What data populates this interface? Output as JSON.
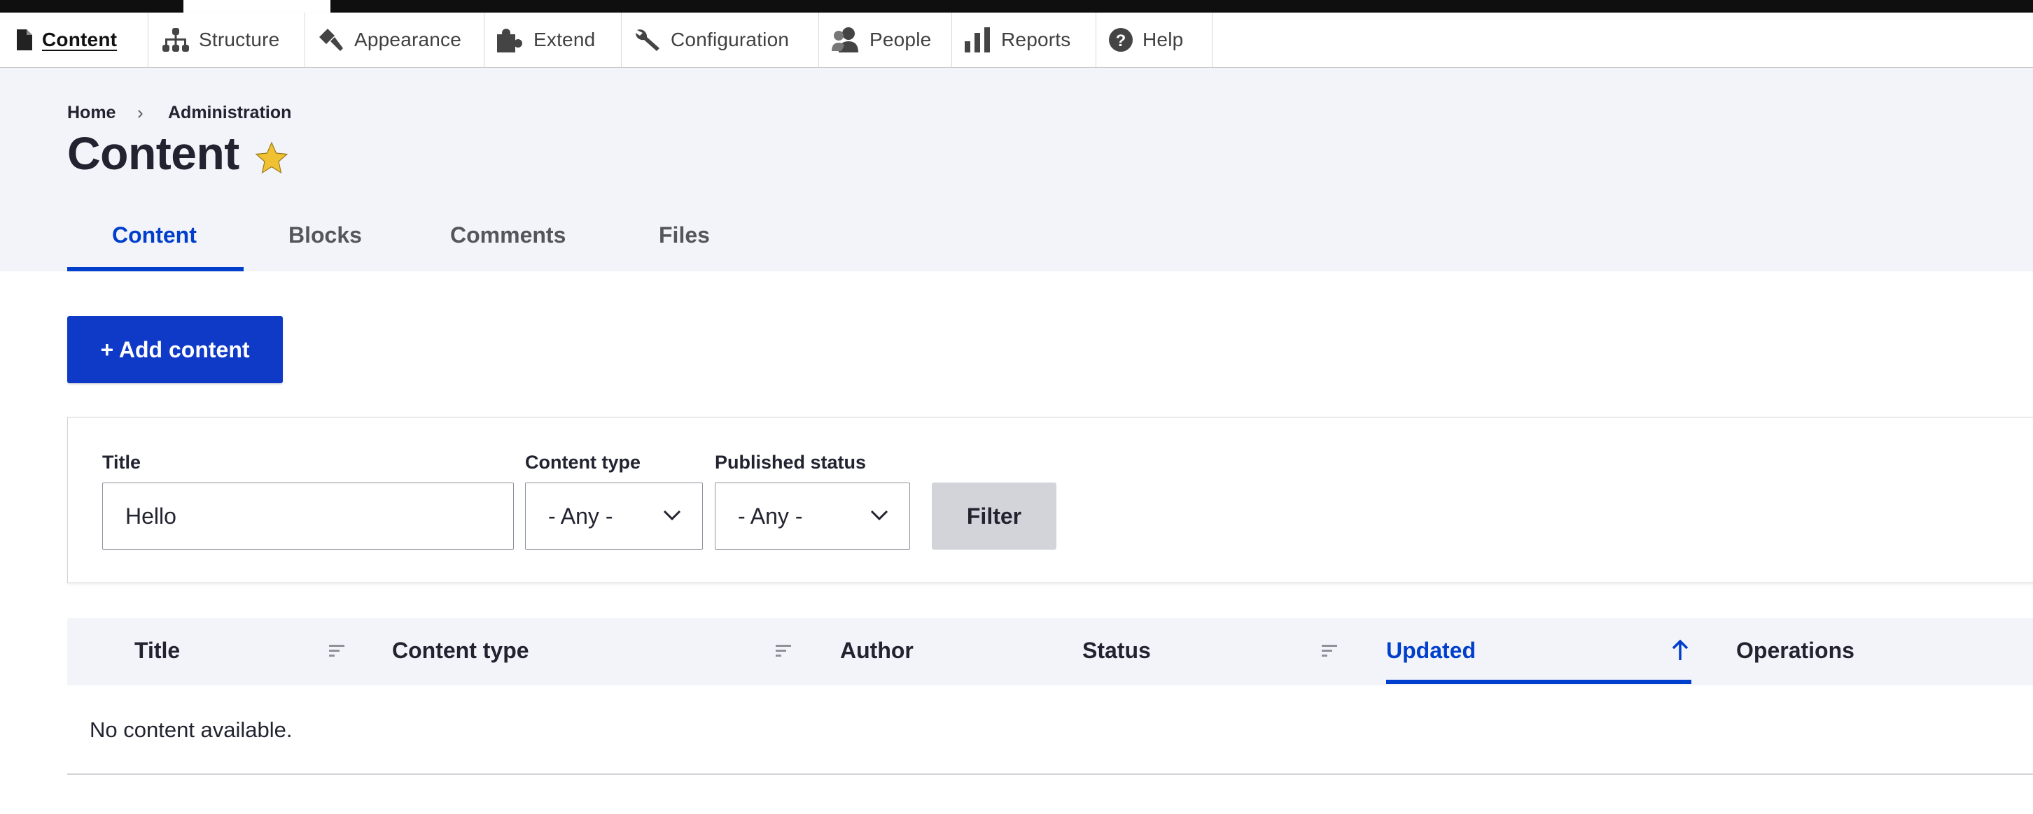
{
  "toolbar": {
    "items": [
      {
        "label": "Content",
        "icon": "file-icon"
      },
      {
        "label": "Structure",
        "icon": "sitemap-icon"
      },
      {
        "label": "Appearance",
        "icon": "paintbrush-icon"
      },
      {
        "label": "Extend",
        "icon": "puzzle-icon"
      },
      {
        "label": "Configuration",
        "icon": "wrench-icon"
      },
      {
        "label": "People",
        "icon": "person-icon"
      },
      {
        "label": "Reports",
        "icon": "bar-chart-icon"
      },
      {
        "label": "Help",
        "icon": "help-icon"
      }
    ],
    "active": "Content"
  },
  "breadcrumb": {
    "home": "Home",
    "admin": "Administration"
  },
  "page": {
    "title": "Content"
  },
  "tabs": [
    {
      "label": "Content"
    },
    {
      "label": "Blocks"
    },
    {
      "label": "Comments"
    },
    {
      "label": "Files"
    }
  ],
  "add_button": "+ Add content",
  "filters": {
    "title_label": "Title",
    "title_value": "Hello",
    "type_label": "Content type",
    "type_value": "- Any -",
    "status_label": "Published status",
    "status_value": "- Any -",
    "submit": "Filter"
  },
  "table": {
    "columns": [
      "Title",
      "Content type",
      "Author",
      "Status",
      "Updated",
      "Operations"
    ],
    "sorted_column": "Updated",
    "empty": "No content available."
  },
  "colors": {
    "accent": "#003ecc",
    "button": "#0f3ac7",
    "header_bg": "#f3f4f9",
    "star": "#f0c233"
  }
}
